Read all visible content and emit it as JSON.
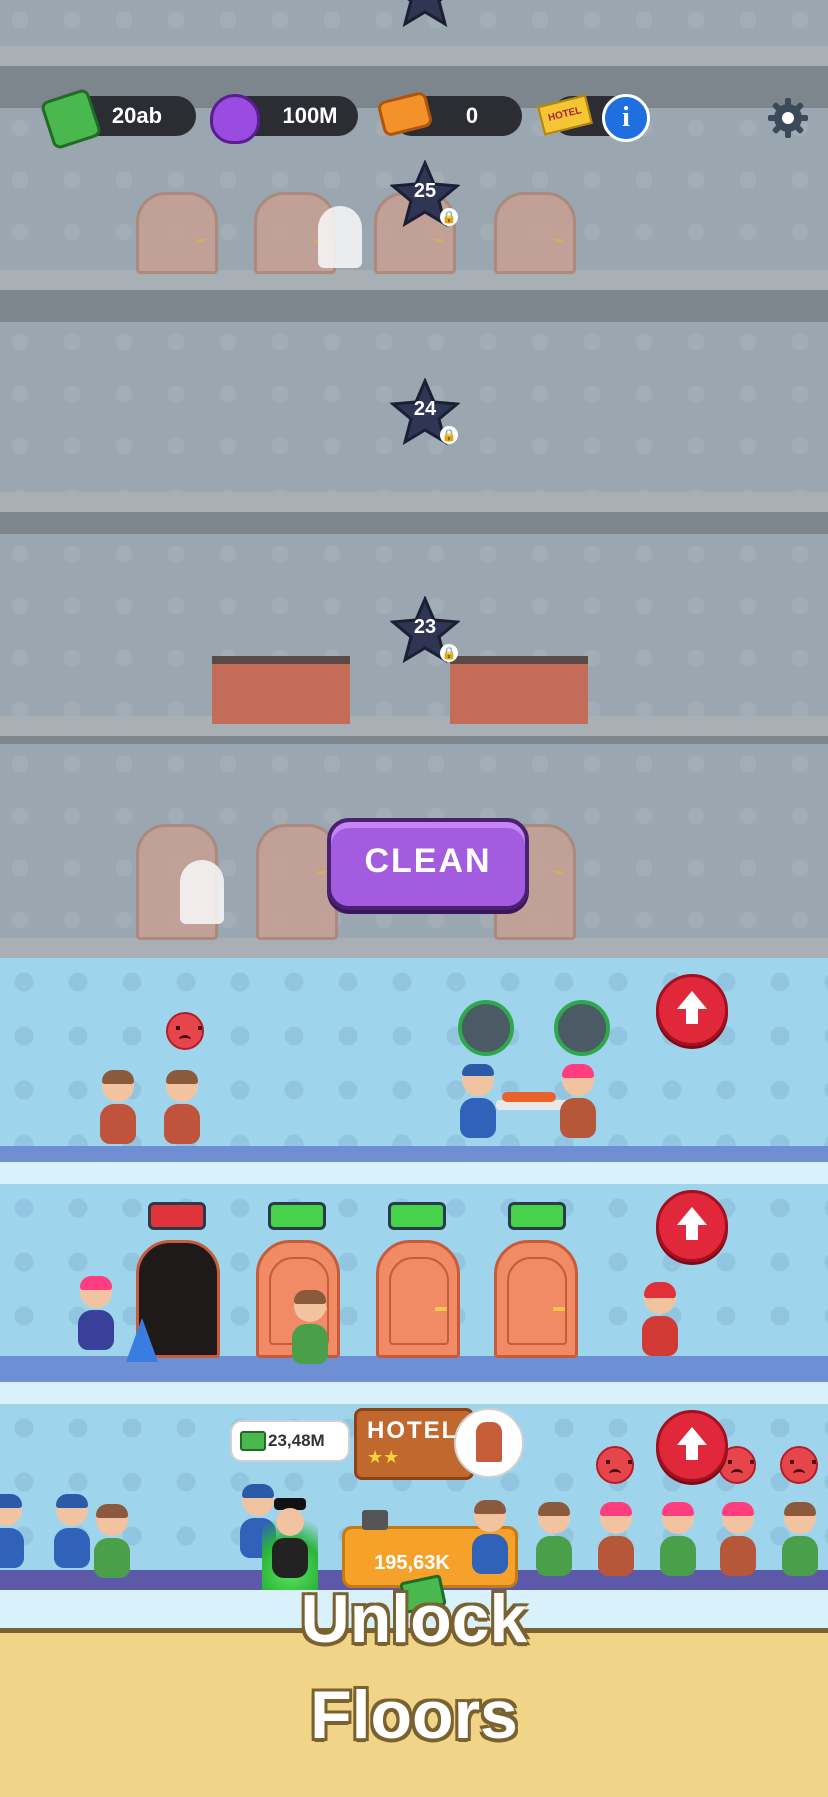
{
  "hud": {
    "cash_value": "20ab",
    "gems_value": "100M",
    "tickets_value": "0",
    "hotel_badge": "HOTEL",
    "info_icon": "info-icon",
    "settings_icon": "gear-icon"
  },
  "locked_floors": [
    {
      "number": "25"
    },
    {
      "number": "24"
    },
    {
      "number": "23"
    }
  ],
  "clean_button": "CLEAN",
  "reception": {
    "cash_bubble": "23,48M",
    "hotel_sign": "HOTEL",
    "hotel_stars": "★★",
    "desk_value": "195,63K"
  },
  "colors": {
    "accent_purple": "#a35be0",
    "upgrade_red": "#e0283a",
    "floor_blue": "#9fd5ec",
    "banner_bg": "#f0d487"
  },
  "banner": {
    "line1": "Unlock",
    "line2": "Floors"
  }
}
